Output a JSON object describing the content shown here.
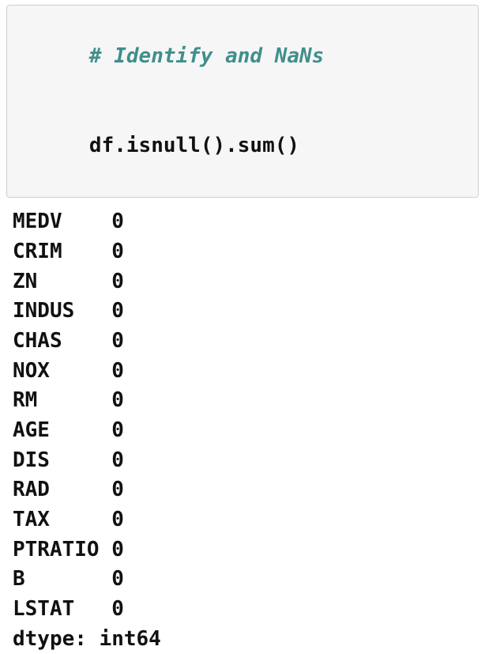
{
  "code": {
    "comment": "# Identify and NaNs",
    "expr_parts": {
      "obj": "df",
      "dot1": ".",
      "fn1": "isnull",
      "paren1": "()",
      "dot2": ".",
      "fn2": "sum",
      "paren2": "()"
    }
  },
  "output": {
    "rows": [
      {
        "label": "MEDV",
        "value": "0"
      },
      {
        "label": "CRIM",
        "value": "0"
      },
      {
        "label": "ZN",
        "value": "0"
      },
      {
        "label": "INDUS",
        "value": "0"
      },
      {
        "label": "CHAS",
        "value": "0"
      },
      {
        "label": "NOX",
        "value": "0"
      },
      {
        "label": "RM",
        "value": "0"
      },
      {
        "label": "AGE",
        "value": "0"
      },
      {
        "label": "DIS",
        "value": "0"
      },
      {
        "label": "RAD",
        "value": "0"
      },
      {
        "label": "TAX",
        "value": "0"
      },
      {
        "label": "PTRATIO",
        "value": "0"
      },
      {
        "label": "B",
        "value": "0"
      },
      {
        "label": "LSTAT",
        "value": "0"
      }
    ],
    "dtype_line": "dtype: int64"
  }
}
